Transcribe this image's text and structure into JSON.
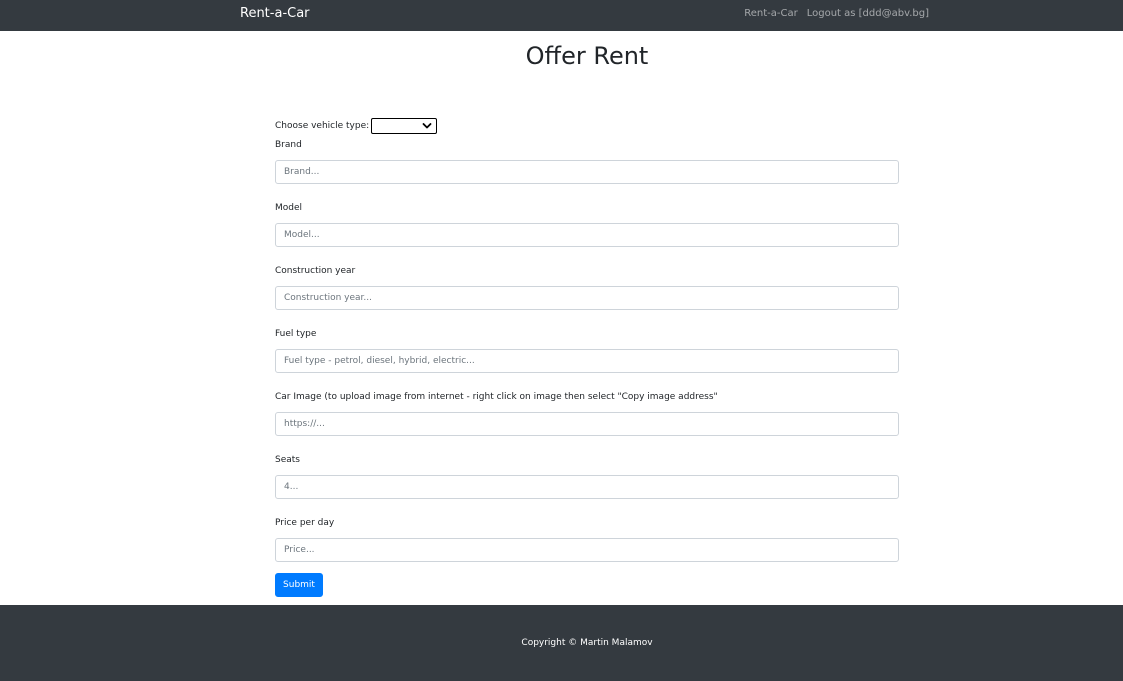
{
  "navbar": {
    "brand": "Rent-a-Car",
    "links": [
      "Rent-a-Car",
      "Logout as [ddd@abv.bg]"
    ]
  },
  "page": {
    "title": "Offer Rent"
  },
  "form": {
    "vehicle_type_label": "Choose vehicle type:",
    "vehicle_type_value": "",
    "fields": [
      {
        "label": "Brand",
        "placeholder": "Brand..."
      },
      {
        "label": "Model",
        "placeholder": "Model..."
      },
      {
        "label": "Construction year",
        "placeholder": "Construction year..."
      },
      {
        "label": "Fuel type",
        "placeholder": "Fuel type - petrol, diesel, hybrid, electric..."
      },
      {
        "label": "Car Image (to upload image from internet - right click on image then select \"Copy image address\"",
        "placeholder": "https://..."
      },
      {
        "label": "Seats",
        "placeholder": "4..."
      },
      {
        "label": "Price per day",
        "placeholder": "Price..."
      }
    ],
    "submit_label": "Submit"
  },
  "footer": {
    "copyright": "Copyright © Martin Malamov"
  },
  "colors": {
    "navbar_bg": "#343a40",
    "primary": "#007bff"
  },
  "icons": {
    "select_arrow": "chevron-down-icon"
  }
}
